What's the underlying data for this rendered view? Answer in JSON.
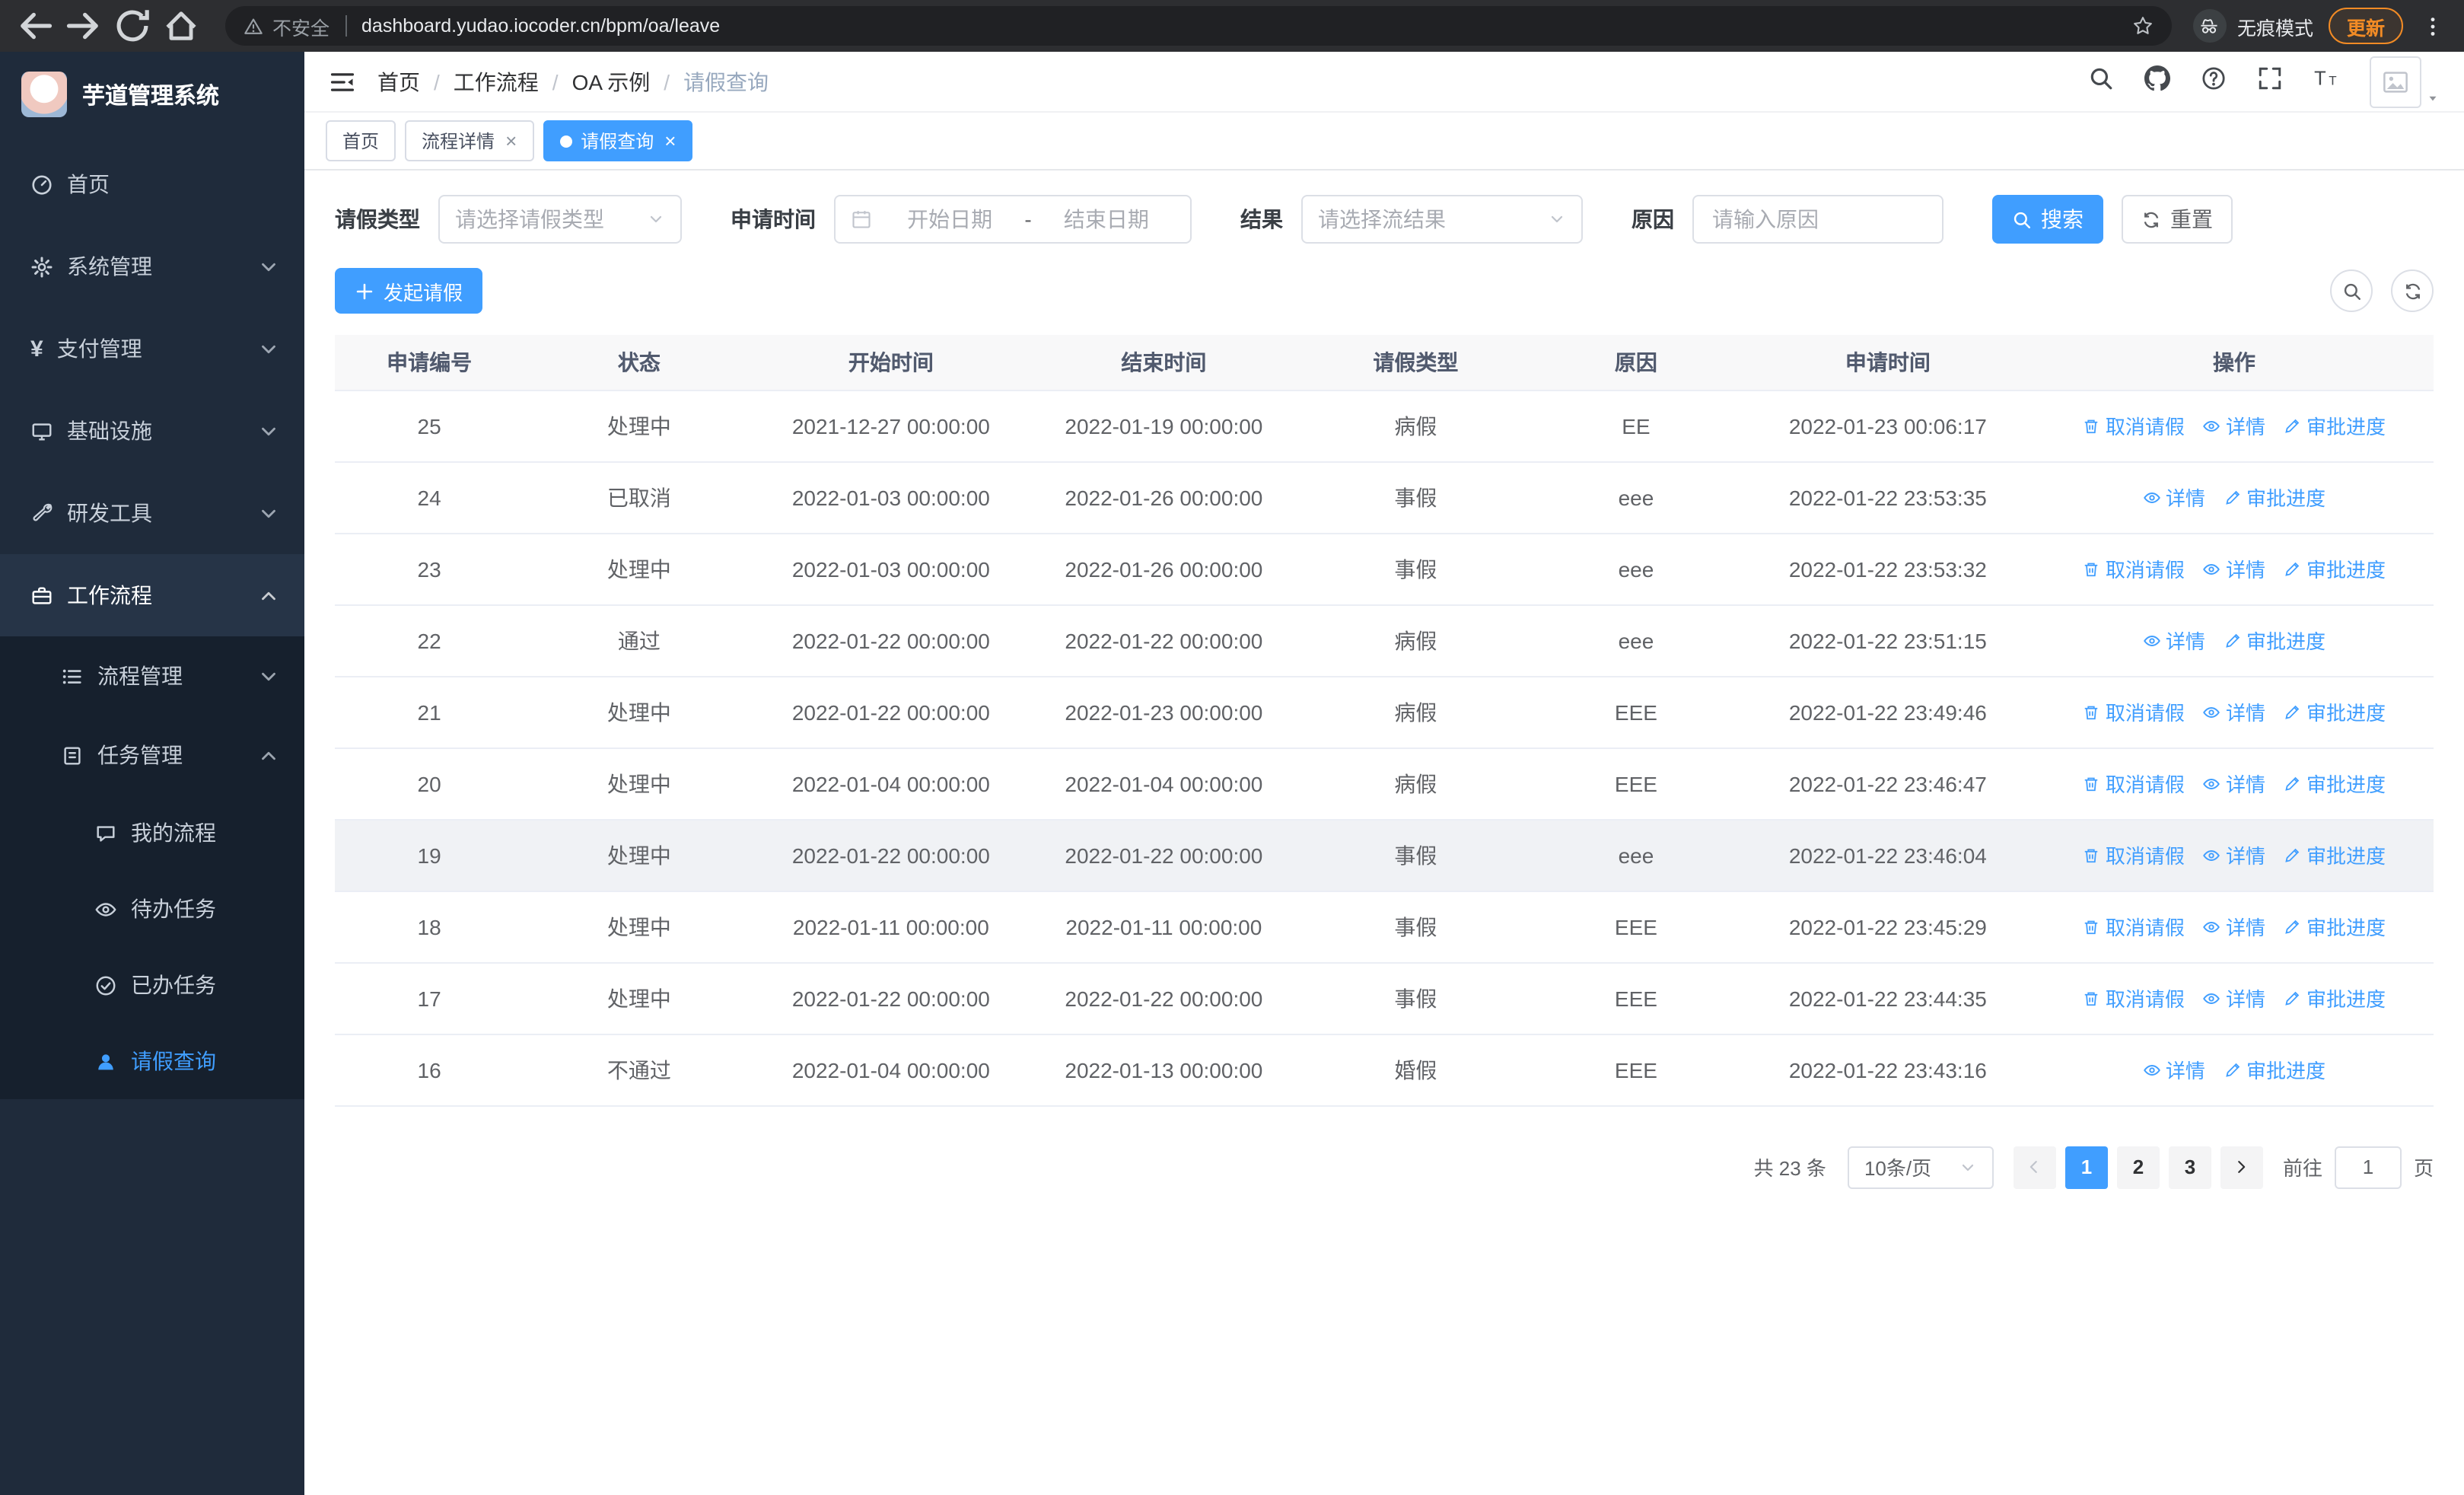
{
  "colors": {
    "accent": "#409eff",
    "sidebar_bg": "#1f2b3b",
    "update_chip": "#f28b25",
    "table_border": "#ebeef5"
  },
  "browser": {
    "security_label": "不安全",
    "url": "dashboard.yudao.iocoder.cn/bpm/oa/leave",
    "incognito_label": "无痕模式",
    "update_label": "更新",
    "nav_icons": [
      "back-icon",
      "forward-icon",
      "reload-icon",
      "home-icon"
    ]
  },
  "sidebar": {
    "app_title": "芋道管理系统",
    "items": [
      {
        "key": "home",
        "label": "首页",
        "icon": "dashboard-icon",
        "level": 1
      },
      {
        "key": "system",
        "label": "系统管理",
        "icon": "gear-icon",
        "level": 1,
        "chevron": "down"
      },
      {
        "key": "payment",
        "label": "支付管理",
        "icon": "yen-icon",
        "level": 1,
        "chevron": "down"
      },
      {
        "key": "infrastructure",
        "label": "基础设施",
        "icon": "infra-icon",
        "level": 1,
        "chevron": "down"
      },
      {
        "key": "devtools",
        "label": "研发工具",
        "icon": "tools-icon",
        "level": 1,
        "chevron": "down"
      },
      {
        "key": "workflow",
        "label": "工作流程",
        "icon": "workflow-icon",
        "level": 1,
        "chevron": "up",
        "expanded": true
      },
      {
        "key": "process-management",
        "label": "流程管理",
        "icon": "process-icon",
        "level": 2,
        "chevron": "down"
      },
      {
        "key": "task-management",
        "label": "任务管理",
        "icon": "tasks-icon",
        "level": 2,
        "chevron": "up",
        "expanded": true
      },
      {
        "key": "my-process",
        "label": "我的流程",
        "icon": "chat-icon",
        "level": 3
      },
      {
        "key": "todo-tasks",
        "label": "待办任务",
        "icon": "eye-icon",
        "level": 3
      },
      {
        "key": "done-tasks",
        "label": "已办任务",
        "icon": "check-icon",
        "level": 3
      },
      {
        "key": "leave-query",
        "label": "请假查询",
        "icon": "user-icon",
        "level": 3,
        "active": true
      }
    ]
  },
  "topbar": {
    "breadcrumb": [
      "首页",
      "工作流程",
      "OA 示例",
      "请假查询"
    ],
    "icons": [
      "search-icon",
      "github-icon",
      "question-icon",
      "fullscreen-icon",
      "fontsize-icon"
    ]
  },
  "tags": [
    {
      "label": "首页",
      "closable": false,
      "active": false
    },
    {
      "label": "流程详情",
      "closable": true,
      "active": false
    },
    {
      "label": "请假查询",
      "closable": true,
      "active": true
    }
  ],
  "filters": {
    "type_label": "请假类型",
    "type_placeholder": "请选择请假类型",
    "time_label": "申请时间",
    "start_placeholder": "开始日期",
    "range_separator": "-",
    "end_placeholder": "结束日期",
    "result_label": "结果",
    "result_placeholder": "请选择流结果",
    "reason_label": "原因",
    "reason_placeholder": "请输入原因",
    "search_button": "搜索",
    "reset_button": "重置"
  },
  "toolbar": {
    "create_button": "发起请假"
  },
  "table": {
    "columns": [
      "申请编号",
      "状态",
      "开始时间",
      "结束时间",
      "请假类型",
      "原因",
      "申请时间",
      "操作"
    ],
    "actions": {
      "cancel": "取消请假",
      "detail": "详情",
      "progress": "审批进度"
    },
    "rows": [
      {
        "id": "25",
        "status": "处理中",
        "start": "2021-12-27 00:00:00",
        "end": "2022-01-19 00:00:00",
        "type": "病假",
        "reason": "EE",
        "apply_time": "2022-01-23 00:06:17",
        "can_cancel": true
      },
      {
        "id": "24",
        "status": "已取消",
        "start": "2022-01-03 00:00:00",
        "end": "2022-01-26 00:00:00",
        "type": "事假",
        "reason": "eee",
        "apply_time": "2022-01-22 23:53:35",
        "can_cancel": false
      },
      {
        "id": "23",
        "status": "处理中",
        "start": "2022-01-03 00:00:00",
        "end": "2022-01-26 00:00:00",
        "type": "事假",
        "reason": "eee",
        "apply_time": "2022-01-22 23:53:32",
        "can_cancel": true
      },
      {
        "id": "22",
        "status": "通过",
        "start": "2022-01-22 00:00:00",
        "end": "2022-01-22 00:00:00",
        "type": "病假",
        "reason": "eee",
        "apply_time": "2022-01-22 23:51:15",
        "can_cancel": false
      },
      {
        "id": "21",
        "status": "处理中",
        "start": "2022-01-22 00:00:00",
        "end": "2022-01-23 00:00:00",
        "type": "病假",
        "reason": "EEE",
        "apply_time": "2022-01-22 23:49:46",
        "can_cancel": true
      },
      {
        "id": "20",
        "status": "处理中",
        "start": "2022-01-04 00:00:00",
        "end": "2022-01-04 00:00:00",
        "type": "病假",
        "reason": "EEE",
        "apply_time": "2022-01-22 23:46:47",
        "can_cancel": true
      },
      {
        "id": "19",
        "status": "处理中",
        "start": "2022-01-22 00:00:00",
        "end": "2022-01-22 00:00:00",
        "type": "事假",
        "reason": "eee",
        "apply_time": "2022-01-22 23:46:04",
        "can_cancel": true,
        "hovered": true
      },
      {
        "id": "18",
        "status": "处理中",
        "start": "2022-01-11 00:00:00",
        "end": "2022-01-11 00:00:00",
        "type": "事假",
        "reason": "EEE",
        "apply_time": "2022-01-22 23:45:29",
        "can_cancel": true
      },
      {
        "id": "17",
        "status": "处理中",
        "start": "2022-01-22 00:00:00",
        "end": "2022-01-22 00:00:00",
        "type": "事假",
        "reason": "EEE",
        "apply_time": "2022-01-22 23:44:35",
        "can_cancel": true
      },
      {
        "id": "16",
        "status": "不通过",
        "start": "2022-01-04 00:00:00",
        "end": "2022-01-13 00:00:00",
        "type": "婚假",
        "reason": "EEE",
        "apply_time": "2022-01-22 23:43:16",
        "can_cancel": false
      }
    ]
  },
  "pagination": {
    "total_label": "共 23 条",
    "page_size": "10条/页",
    "pages": [
      "1",
      "2",
      "3"
    ],
    "active_page": "1",
    "goto_label": "前往",
    "goto_value": "1",
    "page_suffix": "页"
  }
}
